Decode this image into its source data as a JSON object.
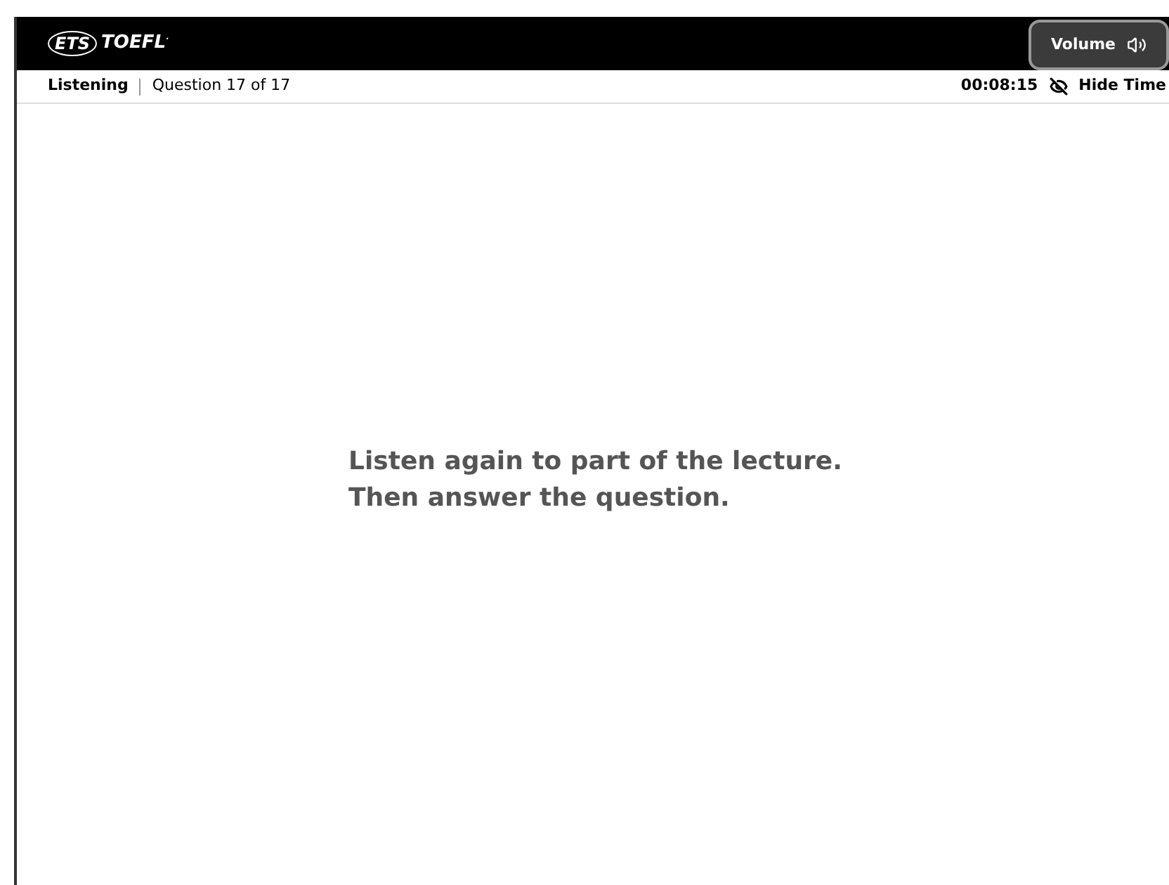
{
  "header": {
    "logo_mark": "ETS",
    "logo_text": "TOEFL",
    "logo_suffix": ".",
    "volume_button": "Volume"
  },
  "status_bar": {
    "section": "Listening",
    "progress": "Question 17 of 17",
    "timer": "00:08:15",
    "hide_time_button": "Hide Time"
  },
  "instructions": [
    "Listen again to part of the lecture.",
    "Then answer the question."
  ]
}
